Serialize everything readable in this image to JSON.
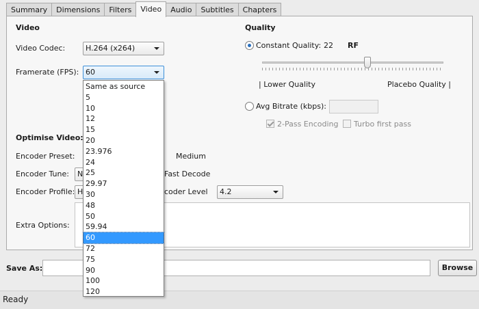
{
  "tabs": [
    {
      "label": "Summary",
      "active": false
    },
    {
      "label": "Dimensions",
      "active": false
    },
    {
      "label": "Filters",
      "active": false
    },
    {
      "label": "Video",
      "active": true
    },
    {
      "label": "Audio",
      "active": false
    },
    {
      "label": "Subtitles",
      "active": false
    },
    {
      "label": "Chapters",
      "active": false
    }
  ],
  "video": {
    "section_title": "Video",
    "codec_label": "Video Codec:",
    "codec_value": "H.264 (x264)",
    "framerate_label": "Framerate (FPS):",
    "framerate_value": "60",
    "framerate_options": [
      "Same as source",
      "5",
      "10",
      "12",
      "15",
      "20",
      "23.976",
      "24",
      "25",
      "29.97",
      "30",
      "48",
      "50",
      "59.94",
      "60",
      "72",
      "75",
      "90",
      "100",
      "120"
    ],
    "framerate_selected_index": 14
  },
  "quality": {
    "section_title": "Quality",
    "constant_label": "Constant Quality:",
    "constant_value": "22",
    "rf_label": "RF",
    "constant_selected": true,
    "slider_fraction": 0.58,
    "lower_label": "| Lower Quality",
    "placebo_label": "Placebo Quality |",
    "avg_label": "Avg Bitrate (kbps):",
    "avg_value": "",
    "two_pass_label": "2-Pass Encoding",
    "two_pass_checked": true,
    "turbo_label": "Turbo first pass",
    "turbo_checked": false
  },
  "optimise": {
    "section_title": "Optimise Video:",
    "preset_label": "Encoder Preset:",
    "preset_value": "Medium",
    "tune_label": "Encoder Tune:",
    "tune_value": "N",
    "fast_decode_label": "Fast Decode",
    "profile_label": "Encoder Profile:",
    "profile_value": "H",
    "level_label": "coder Level",
    "level_value": "4.2",
    "extra_label": "Extra Options:"
  },
  "save": {
    "label": "Save As:",
    "value": "",
    "browse_label": "Browse"
  },
  "status": {
    "text": "Ready"
  }
}
